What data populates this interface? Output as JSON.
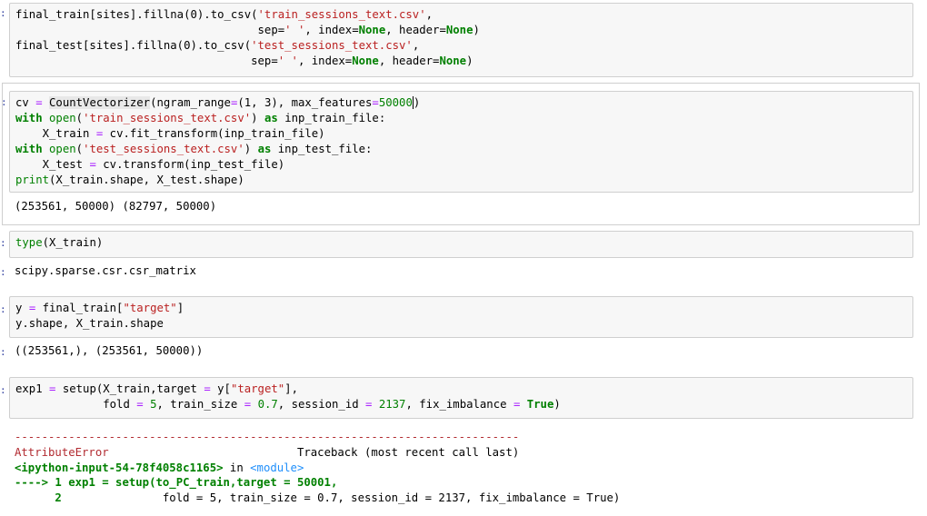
{
  "cells": {
    "c1": {
      "line1a": "final_train[sites].fillna(0).to_csv(",
      "line1b": "'train_sessions_text.csv'",
      "line2a": "sep=",
      "line2b": "' '",
      "line2c": ", index=",
      "none": "None",
      "line2d": ", header=",
      "line2e": ")",
      "line3a": "final_test[sites].fillna(0).to_csv(",
      "line3b": "'test_sessions_text.csv'",
      "line3c": ","
    },
    "c2": {
      "cv": "cv ",
      "eq": "=",
      "cvec": "CountVectorizer",
      "args1": "(ngram_range",
      "tuple": "(1, 3)",
      "args2": ", max_features",
      "maxf": "50000",
      "close": ")",
      "with": "with",
      "open": "open",
      "train_csv": "'train_sessions_text.csv'",
      "as": "as",
      "inp_train": "inp_train_file:",
      "xtrain_line": "X_train ",
      "fit_call": " cv.fit_transform(inp_train_file)",
      "test_csv": "'test_sessions_text.csv'",
      "inp_test": "inp_test_file:",
      "xtest_line": "X_test ",
      "trans_call": " cv.transform(inp_test_file)",
      "print": "print",
      "print_args": "(X_train.shape, X_test.shape)",
      "output": "(253561, 50000) (82797, 50000)"
    },
    "c3": {
      "type": "type",
      "args": "(X_train)",
      "output": "scipy.sparse.csr.csr_matrix"
    },
    "c4": {
      "y": "y ",
      "rhs": " final_train[",
      "target": "\"target\"",
      "close": "]",
      "line2": "y.shape, X_train.shape",
      "output": "((253561,), (253561, 50000))"
    },
    "c5": {
      "l1a": "exp1 ",
      "l1b": " setup(X_train,target ",
      "l1c": " y[",
      "l1d": "\"target\"",
      "l1e": "],",
      "l2a": "fold ",
      "five": "5",
      "l2b": ", train_size ",
      "frac": "0.7",
      "l2c": ", session_id ",
      "sid": "2137",
      "l2d": ", fix_imbalance ",
      "true": "True",
      "l2e": ")"
    },
    "traceback": {
      "dashes": "---------------------------------------------------------------------------",
      "error": "AttributeError",
      "tb_header": "Traceback (most recent call last)",
      "ipy": "<ipython-input-54-78f4058c1165>",
      "in": " in ",
      "module": "<module>",
      "arrow": "----> 1 ",
      "l1": "exp1 = setup(to_PC_train,target = 50001,",
      "lineno2": "      2 ",
      "l2": "              fold = 5, train_size = 0.7, session_id = 2137, fix_imbalance = True)"
    },
    "prompt_mark": ":"
  }
}
